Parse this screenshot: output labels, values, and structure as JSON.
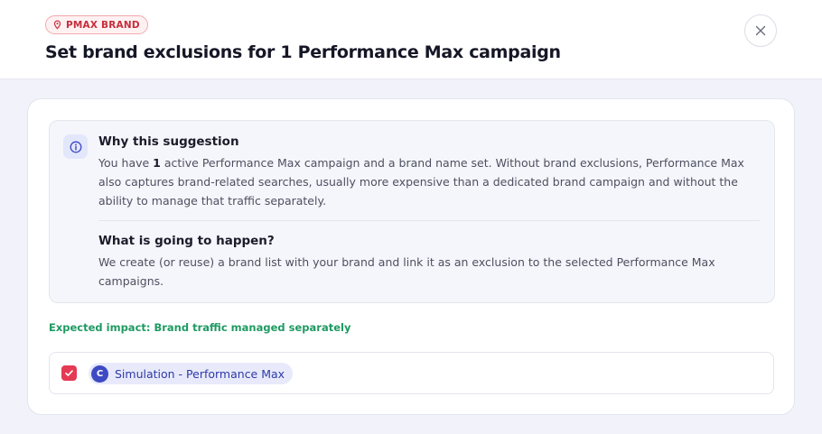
{
  "header": {
    "badge_label": "PMAX BRAND",
    "title": "Set brand exclusions for 1 Performance Max campaign"
  },
  "suggestion": {
    "why_title": "Why this suggestion",
    "why_body_prefix": "You have ",
    "why_body_count": "1",
    "why_body_rest": " active Performance Max campaign and a brand name set. Without brand exclusions, Performance Max also captures brand-related searches, usually more expensive than a dedicated brand campaign and without the ability to manage that traffic separately.",
    "happen_title": "What is going to happen?",
    "happen_body": "We create (or reuse) a brand list with your brand and link it as an exclusion to the selected Performance Max campaigns."
  },
  "impact": "Expected impact: Brand traffic managed separately",
  "campaigns": [
    {
      "avatar": "C",
      "name": "Simulation - Performance Max",
      "checked": true
    }
  ],
  "colors": {
    "badge": "#c62e3c",
    "impact": "#1e9a62",
    "checkbox": "#e53a54",
    "chip_avatar": "#3d4ac4"
  },
  "icons": {
    "badge": "map-pin-icon",
    "close": "close-icon",
    "info": "info-icon",
    "checkbox": "check-icon"
  }
}
